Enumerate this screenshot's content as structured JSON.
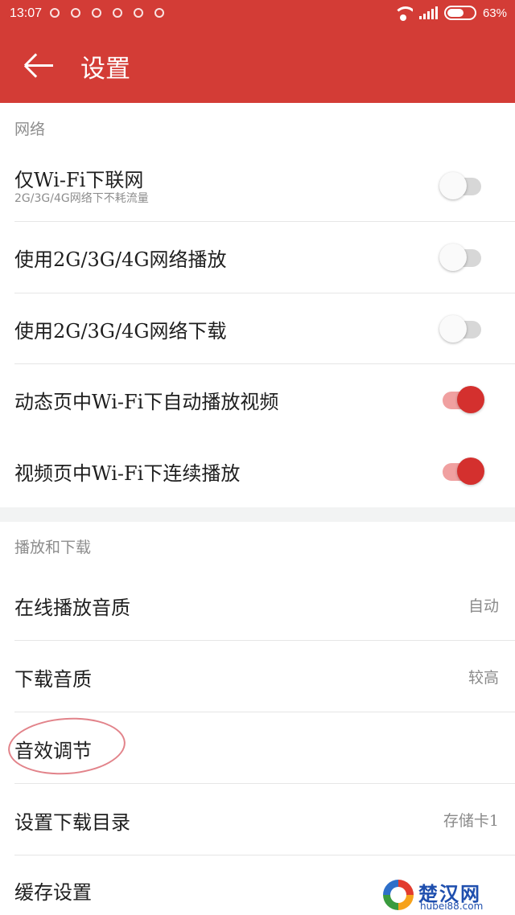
{
  "status_bar": {
    "time": "13:07",
    "battery_text": "63%",
    "battery_level": 0.63
  },
  "app_bar": {
    "title": "设置",
    "back_icon": "arrow-left-icon"
  },
  "sections": {
    "network": {
      "header": "网络",
      "rows": [
        {
          "label": "仅Wi-Fi下联网",
          "sub": "2G/3G/4G网络下不耗流量",
          "toggle_on": false
        },
        {
          "label": "使用2G/3G/4G网络播放",
          "toggle_on": false
        },
        {
          "label": "使用2G/3G/4G网络下载",
          "toggle_on": false
        },
        {
          "label": "动态页中Wi-Fi下自动播放视频",
          "toggle_on": true
        },
        {
          "label": "视频页中Wi-Fi下连续播放",
          "toggle_on": true
        }
      ]
    },
    "playback": {
      "header": "播放和下载",
      "rows": [
        {
          "label": "在线播放音质",
          "value": "自动"
        },
        {
          "label": "下载音质",
          "value": "较高"
        },
        {
          "label": "音效调节",
          "value": ""
        },
        {
          "label": "设置下载目录",
          "value": "存储卡1"
        },
        {
          "label": "缓存设置",
          "value": ""
        }
      ]
    }
  },
  "watermark": {
    "title": "楚汉网",
    "url": "hubei88.com"
  },
  "colors": {
    "accent": "#d33c36",
    "toggle_on": "#d4302e",
    "annotation": "#e2838a"
  }
}
